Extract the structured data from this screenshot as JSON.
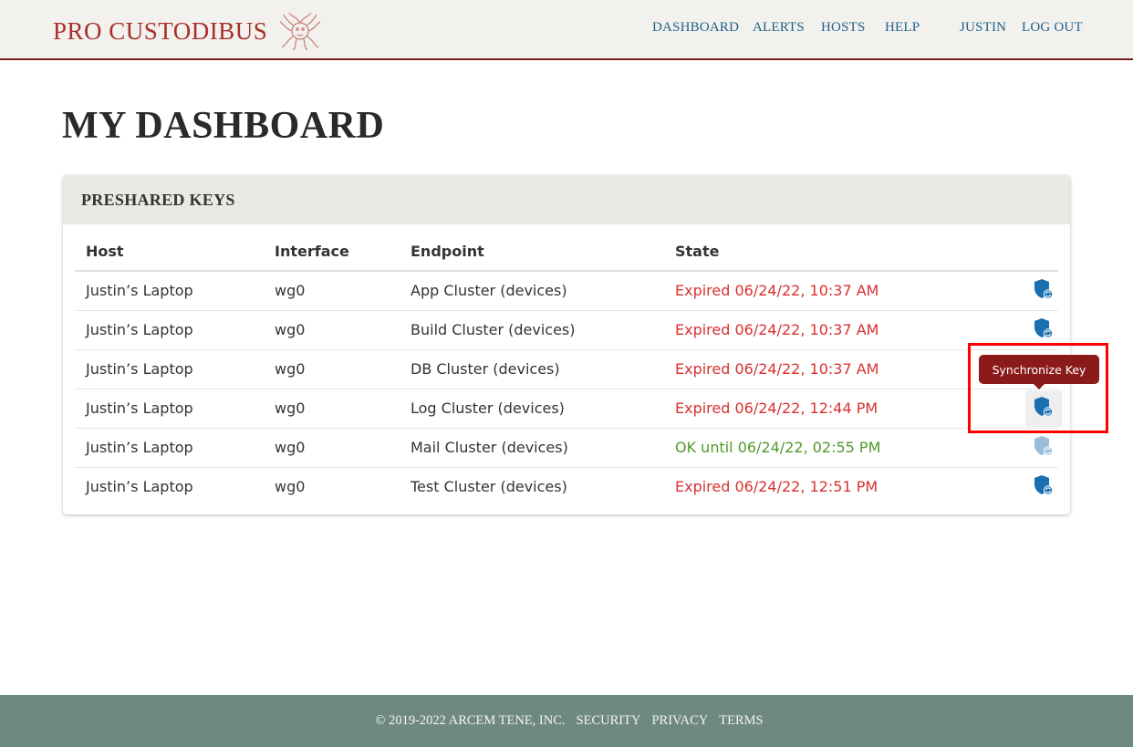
{
  "brand": {
    "name": "PRO CUSTODIBUS",
    "logo_icon": "medusa-logo-icon"
  },
  "nav": {
    "dashboard": "DASHBOARD",
    "alerts": "ALERTS",
    "hosts": "HOSTS",
    "help": "HELP",
    "user": "JUSTIN",
    "logout": "LOG OUT"
  },
  "page": {
    "title": "MY DASHBOARD"
  },
  "card": {
    "title": "PRESHARED KEYS",
    "columns": {
      "host": "Host",
      "interface": "Interface",
      "endpoint": "Endpoint",
      "state": "State"
    },
    "rows": [
      {
        "host": "Justin’s Laptop",
        "interface": "wg0",
        "endpoint": "App Cluster (devices)",
        "state": "Expired 06/24/22, 10:37 AM",
        "status": "expired"
      },
      {
        "host": "Justin’s Laptop",
        "interface": "wg0",
        "endpoint": "Build Cluster (devices)",
        "state": "Expired 06/24/22, 10:37 AM",
        "status": "expired"
      },
      {
        "host": "Justin’s Laptop",
        "interface": "wg0",
        "endpoint": "DB Cluster (devices)",
        "state": "Expired 06/24/22, 10:37 AM",
        "status": "expired"
      },
      {
        "host": "Justin’s Laptop",
        "interface": "wg0",
        "endpoint": "Log Cluster (devices)",
        "state": "Expired 06/24/22, 12:44 PM",
        "status": "expired"
      },
      {
        "host": "Justin’s Laptop",
        "interface": "wg0",
        "endpoint": "Mail Cluster (devices)",
        "state": "OK until 06/24/22, 02:55 PM",
        "status": "ok"
      },
      {
        "host": "Justin’s Laptop",
        "interface": "wg0",
        "endpoint": "Test Cluster (devices)",
        "state": "Expired 06/24/22, 12:51 PM",
        "status": "expired"
      }
    ],
    "action_icon": "shield-sync-icon"
  },
  "tooltip": {
    "text": "Synchronize Key"
  },
  "footer": {
    "copyright": "© 2019-2022 ARCEM TENE, INC.",
    "security": "SECURITY",
    "privacy": "PRIVACY",
    "terms": "TERMS"
  },
  "colors": {
    "brand": "#a8302a",
    "nav_link": "#1f5f8b",
    "expired": "#d93030",
    "ok": "#4f9a2a",
    "icon": "#1a6fb0",
    "tooltip_bg": "#8b1a1a",
    "footer_bg": "#6e8a80",
    "highlight": "#ff0000"
  }
}
